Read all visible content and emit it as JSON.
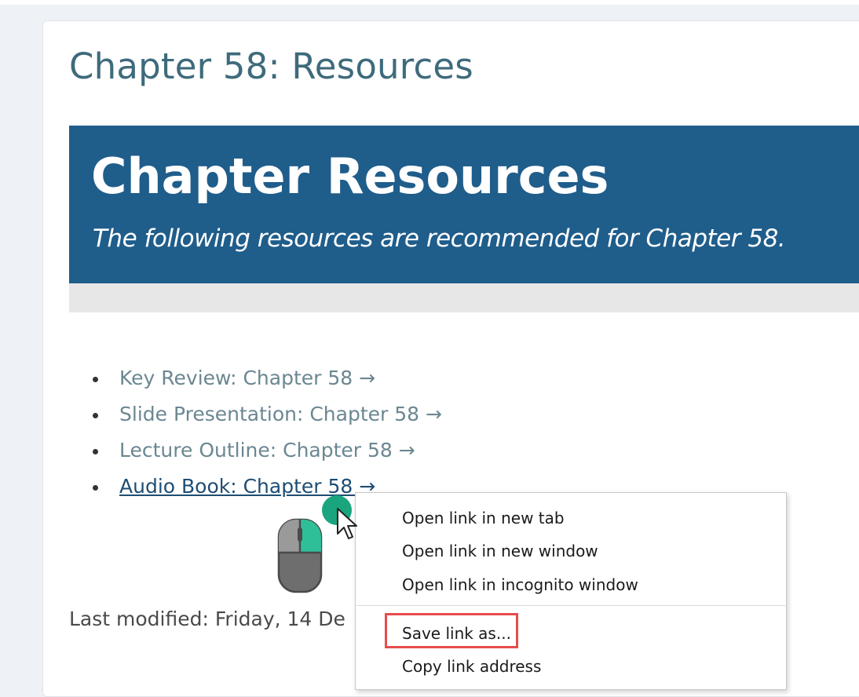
{
  "page": {
    "title": "Chapter 58: Resources",
    "last_modified": "Last modified: Friday, 14 De"
  },
  "banner": {
    "title": "Chapter Resources",
    "subtitle": "The following resources are recommended for Chapter 58."
  },
  "resources": [
    {
      "label": "Key Review: Chapter 58 →"
    },
    {
      "label": "Slide Presentation: Chapter 58 →"
    },
    {
      "label": "Lecture Outline: Chapter 58 →"
    },
    {
      "label": "Audio Book: Chapter 58 →"
    }
  ],
  "context_menu": {
    "items": [
      {
        "label": "Open link in new tab"
      },
      {
        "label": "Open link in new window"
      },
      {
        "label": "Open link in incognito window"
      },
      {
        "label": "Save link as..."
      },
      {
        "label": "Copy link address"
      }
    ]
  },
  "colors": {
    "banner": "#1f5d8b",
    "title": "#3e6b7c",
    "link": "#6b8791",
    "active_link": "#1f4d73",
    "highlight": "#e84c4c",
    "cursor_accent": "#1aa57f"
  },
  "icons": {
    "cursor": "arrow-cursor-icon",
    "mouse": "mouse-left-click-icon"
  }
}
